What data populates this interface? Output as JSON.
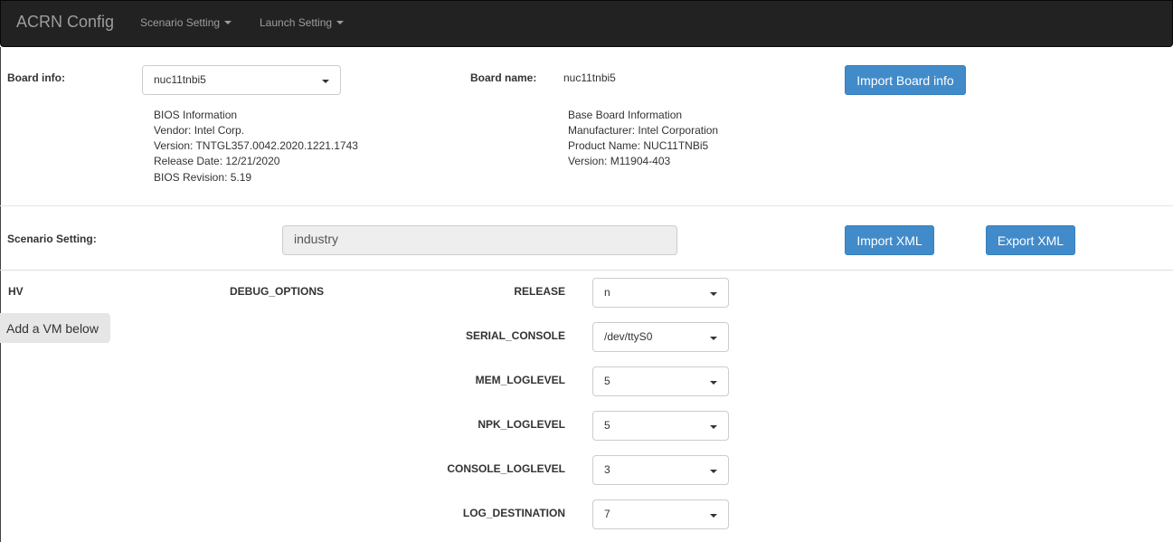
{
  "navbar": {
    "brand": "ACRN Config",
    "menus": [
      {
        "label": "Scenario Setting"
      },
      {
        "label": "Launch Setting"
      }
    ]
  },
  "board": {
    "info_label": "Board info:",
    "info_value": "nuc11tnbi5",
    "name_label": "Board name:",
    "name_value": "nuc11tnbi5",
    "import_button": "Import Board info",
    "bios_lines": [
      "BIOS Information",
      "Vendor: Intel Corp.",
      "Version: TNTGL357.0042.2020.1221.1743",
      "Release Date: 12/21/2020",
      "BIOS Revision: 5.19"
    ],
    "baseboard_lines": [
      "Base Board Information",
      "Manufacturer: Intel Corporation",
      "Product Name: NUC11TNBi5",
      "Version: M11904-403"
    ]
  },
  "scenario": {
    "label": "Scenario Setting:",
    "value": "industry",
    "import_button": "Import XML",
    "export_button": "Export XML"
  },
  "hv": {
    "section_label": "HV",
    "group_label": "DEBUG_OPTIONS",
    "add_vm_label": "Add a VM below",
    "options": [
      {
        "label": "RELEASE",
        "value": "n"
      },
      {
        "label": "SERIAL_CONSOLE",
        "value": "/dev/ttyS0"
      },
      {
        "label": "MEM_LOGLEVEL",
        "value": "5"
      },
      {
        "label": "NPK_LOGLEVEL",
        "value": "5"
      },
      {
        "label": "CONSOLE_LOGLEVEL",
        "value": "3"
      },
      {
        "label": "LOG_DESTINATION",
        "value": "7"
      }
    ]
  }
}
